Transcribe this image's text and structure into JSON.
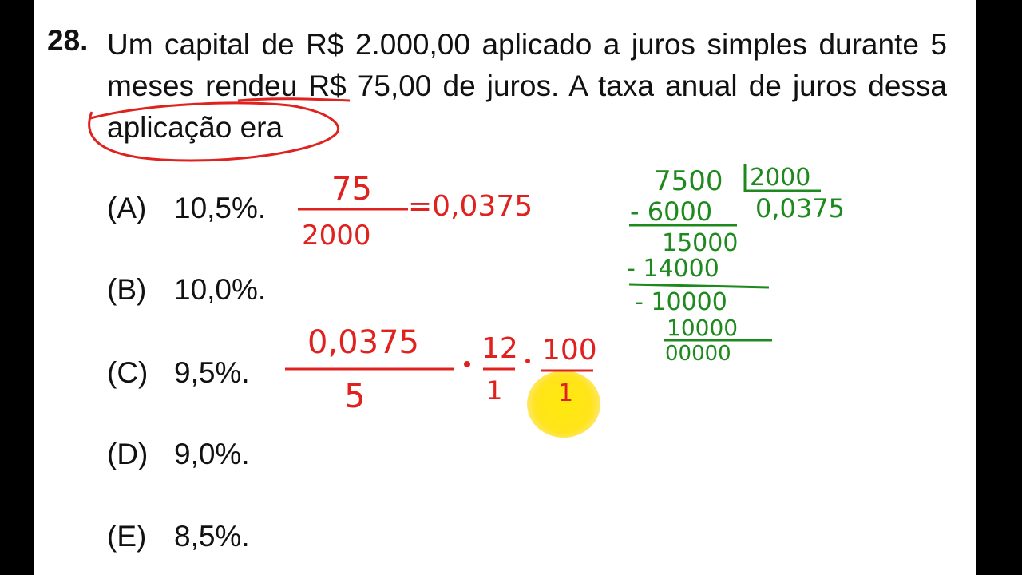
{
  "question": {
    "number": "28.",
    "text": "Um capital de R$ 2.000,00 aplicado a juros simples durante 5 meses rendeu R$ 75,00 de juros. A taxa anual de juros dessa aplicação era"
  },
  "options": [
    {
      "letter": "(A)",
      "value": "10,5%."
    },
    {
      "letter": "(B)",
      "value": "10,0%."
    },
    {
      "letter": "(C)",
      "value": "9,5%."
    },
    {
      "letter": "(D)",
      "value": "9,0%."
    },
    {
      "letter": "(E)",
      "value": "8,5%."
    }
  ],
  "annotations": {
    "fraction_numerator": "75",
    "fraction_denominator": "2000",
    "fraction_result": "=0,0375",
    "calc_numerator": "0,0375",
    "calc_denominator": "5",
    "times_12": "12",
    "times_12_den": "1",
    "times_100": "100",
    "times_100_den": "1",
    "division": {
      "dividend": "7500",
      "divisor": "2000",
      "quotient": "0,0375",
      "steps": [
        "- 6000",
        "15000",
        "- 14000",
        "- 10000",
        "10000",
        "00000"
      ]
    },
    "colors": {
      "red": "#e0221f",
      "green": "#1e8a1e"
    }
  }
}
